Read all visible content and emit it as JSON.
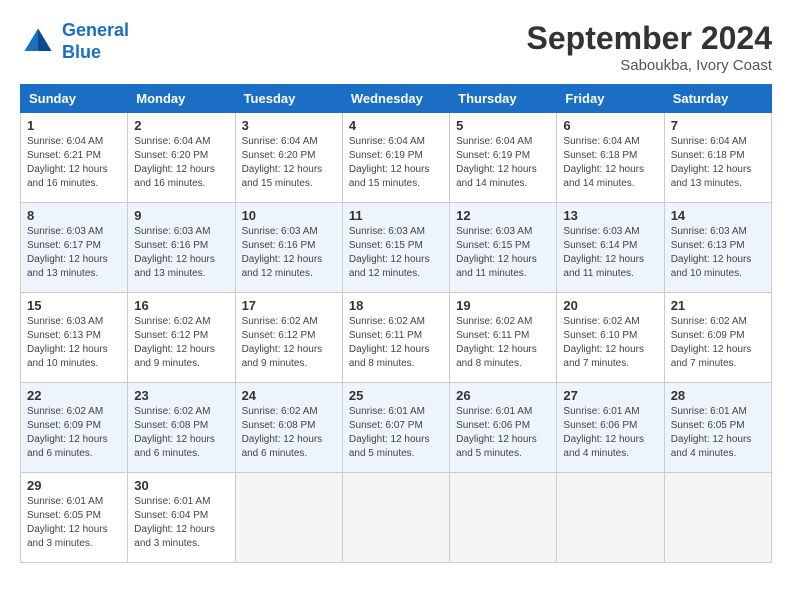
{
  "header": {
    "logo_line1": "General",
    "logo_line2": "Blue",
    "month_year": "September 2024",
    "location": "Saboukba, Ivory Coast"
  },
  "weekdays": [
    "Sunday",
    "Monday",
    "Tuesday",
    "Wednesday",
    "Thursday",
    "Friday",
    "Saturday"
  ],
  "weeks": [
    {
      "days": [
        null,
        {
          "num": 2,
          "sunrise": "6:04 AM",
          "sunset": "6:20 PM",
          "daylight": "12 hours and 16 minutes."
        },
        {
          "num": 3,
          "sunrise": "6:04 AM",
          "sunset": "6:20 PM",
          "daylight": "12 hours and 15 minutes."
        },
        {
          "num": 4,
          "sunrise": "6:04 AM",
          "sunset": "6:19 PM",
          "daylight": "12 hours and 15 minutes."
        },
        {
          "num": 5,
          "sunrise": "6:04 AM",
          "sunset": "6:19 PM",
          "daylight": "12 hours and 14 minutes."
        },
        {
          "num": 6,
          "sunrise": "6:04 AM",
          "sunset": "6:18 PM",
          "daylight": "12 hours and 14 minutes."
        },
        {
          "num": 7,
          "sunrise": "6:04 AM",
          "sunset": "6:18 PM",
          "daylight": "12 hours and 13 minutes."
        }
      ],
      "first_day": 1,
      "first_sunrise": "6:04 AM",
      "first_sunset": "6:21 PM",
      "first_daylight": "12 hours and 16 minutes."
    },
    {
      "days": [
        {
          "num": 8,
          "sunrise": "6:03 AM",
          "sunset": "6:17 PM",
          "daylight": "12 hours and 13 minutes."
        },
        {
          "num": 9,
          "sunrise": "6:03 AM",
          "sunset": "6:16 PM",
          "daylight": "12 hours and 13 minutes."
        },
        {
          "num": 10,
          "sunrise": "6:03 AM",
          "sunset": "6:16 PM",
          "daylight": "12 hours and 12 minutes."
        },
        {
          "num": 11,
          "sunrise": "6:03 AM",
          "sunset": "6:15 PM",
          "daylight": "12 hours and 12 minutes."
        },
        {
          "num": 12,
          "sunrise": "6:03 AM",
          "sunset": "6:15 PM",
          "daylight": "12 hours and 11 minutes."
        },
        {
          "num": 13,
          "sunrise": "6:03 AM",
          "sunset": "6:14 PM",
          "daylight": "12 hours and 11 minutes."
        },
        {
          "num": 14,
          "sunrise": "6:03 AM",
          "sunset": "6:13 PM",
          "daylight": "12 hours and 10 minutes."
        }
      ]
    },
    {
      "days": [
        {
          "num": 15,
          "sunrise": "6:03 AM",
          "sunset": "6:13 PM",
          "daylight": "12 hours and 10 minutes."
        },
        {
          "num": 16,
          "sunrise": "6:02 AM",
          "sunset": "6:12 PM",
          "daylight": "12 hours and 9 minutes."
        },
        {
          "num": 17,
          "sunrise": "6:02 AM",
          "sunset": "6:12 PM",
          "daylight": "12 hours and 9 minutes."
        },
        {
          "num": 18,
          "sunrise": "6:02 AM",
          "sunset": "6:11 PM",
          "daylight": "12 hours and 8 minutes."
        },
        {
          "num": 19,
          "sunrise": "6:02 AM",
          "sunset": "6:11 PM",
          "daylight": "12 hours and 8 minutes."
        },
        {
          "num": 20,
          "sunrise": "6:02 AM",
          "sunset": "6:10 PM",
          "daylight": "12 hours and 7 minutes."
        },
        {
          "num": 21,
          "sunrise": "6:02 AM",
          "sunset": "6:09 PM",
          "daylight": "12 hours and 7 minutes."
        }
      ]
    },
    {
      "days": [
        {
          "num": 22,
          "sunrise": "6:02 AM",
          "sunset": "6:09 PM",
          "daylight": "12 hours and 6 minutes."
        },
        {
          "num": 23,
          "sunrise": "6:02 AM",
          "sunset": "6:08 PM",
          "daylight": "12 hours and 6 minutes."
        },
        {
          "num": 24,
          "sunrise": "6:02 AM",
          "sunset": "6:08 PM",
          "daylight": "12 hours and 6 minutes."
        },
        {
          "num": 25,
          "sunrise": "6:01 AM",
          "sunset": "6:07 PM",
          "daylight": "12 hours and 5 minutes."
        },
        {
          "num": 26,
          "sunrise": "6:01 AM",
          "sunset": "6:06 PM",
          "daylight": "12 hours and 5 minutes."
        },
        {
          "num": 27,
          "sunrise": "6:01 AM",
          "sunset": "6:06 PM",
          "daylight": "12 hours and 4 minutes."
        },
        {
          "num": 28,
          "sunrise": "6:01 AM",
          "sunset": "6:05 PM",
          "daylight": "12 hours and 4 minutes."
        }
      ]
    },
    {
      "days": [
        {
          "num": 29,
          "sunrise": "6:01 AM",
          "sunset": "6:05 PM",
          "daylight": "12 hours and 3 minutes."
        },
        {
          "num": 30,
          "sunrise": "6:01 AM",
          "sunset": "6:04 PM",
          "daylight": "12 hours and 3 minutes."
        },
        null,
        null,
        null,
        null,
        null
      ]
    }
  ]
}
